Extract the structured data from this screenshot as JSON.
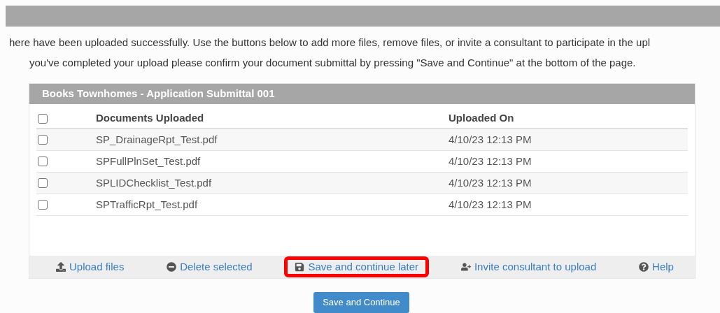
{
  "intro": [
    "here have been uploaded successfully. Use the buttons below to add more files, remove files, or invite a consultant to participate in the upl",
    "you've completed your upload please confirm your document submittal by pressing \"Save and Continue\" at the bottom of the page."
  ],
  "panel": {
    "title": "Books Townhomes - Application Submittal 001",
    "table": {
      "select_all": {
        "checked": false
      },
      "columns": [
        "Documents Uploaded",
        "Uploaded On"
      ],
      "rows": [
        {
          "checked": false,
          "name": "SP_DrainageRpt_Test.pdf",
          "uploaded_on": "4/10/23 12:13 PM"
        },
        {
          "checked": false,
          "name": "SPFullPlnSet_Test.pdf",
          "uploaded_on": "4/10/23 12:13 PM"
        },
        {
          "checked": false,
          "name": "SPLIDChecklist_Test.pdf",
          "uploaded_on": "4/10/23 12:13 PM"
        },
        {
          "checked": false,
          "name": "SPTrafficRpt_Test.pdf",
          "uploaded_on": "4/10/23 12:13 PM"
        }
      ]
    },
    "actions": [
      {
        "kind": "upload",
        "label": "Upload files",
        "highlighted": false
      },
      {
        "kind": "delete",
        "label": "Delete selected",
        "highlighted": false
      },
      {
        "kind": "save",
        "label": "Save and continue later",
        "highlighted": true
      },
      {
        "kind": "invite",
        "label": "Invite consultant to upload",
        "highlighted": false
      },
      {
        "kind": "help",
        "label": "Help",
        "highlighted": false
      }
    ]
  },
  "submit_button": "Save and Continue"
}
